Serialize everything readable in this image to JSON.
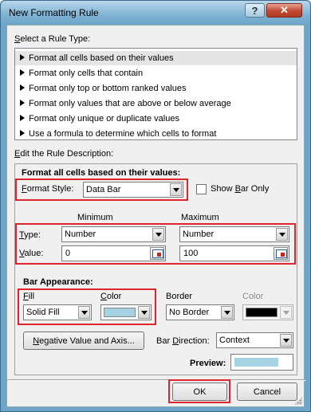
{
  "window": {
    "title": "New Formatting Rule"
  },
  "rule_type": {
    "heading": "Select a Rule Type:",
    "items": [
      "Format all cells based on their values",
      "Format only cells that contain",
      "Format only top or bottom ranked values",
      "Format only values that are above or below average",
      "Format only unique or duplicate values",
      "Use a formula to determine which cells to format"
    ],
    "selected_index": 0
  },
  "description": {
    "heading": "Edit the Rule Description:",
    "subheading": "Format all cells based on their values:",
    "format_style_label": "Format Style:",
    "format_style_value": "Data Bar",
    "show_bar_only_label": "Show Bar Only",
    "show_bar_only_checked": false,
    "minimum_label": "Minimum",
    "maximum_label": "Maximum",
    "type_label": "Type:",
    "value_label": "Value:",
    "min_type": "Number",
    "max_type": "Number",
    "min_value": "0",
    "max_value": "100"
  },
  "bar_appearance": {
    "heading": "Bar Appearance:",
    "fill_label": "Fill",
    "fill_value": "Solid Fill",
    "color_label": "Color",
    "fill_color": "#a6d3e3",
    "border_label": "Border",
    "border_value": "No Border",
    "border_color_label": "Color",
    "border_color": "#000000",
    "negative_button": "Negative Value and Axis...",
    "bar_direction_label": "Bar Direction:",
    "bar_direction_value": "Context",
    "preview_label": "Preview:",
    "preview_fill_percent": 80
  },
  "buttons": {
    "ok": "OK",
    "cancel": "Cancel"
  },
  "colors": {
    "highlight": "#e0242c",
    "titlebar": "#6ea6c9"
  }
}
